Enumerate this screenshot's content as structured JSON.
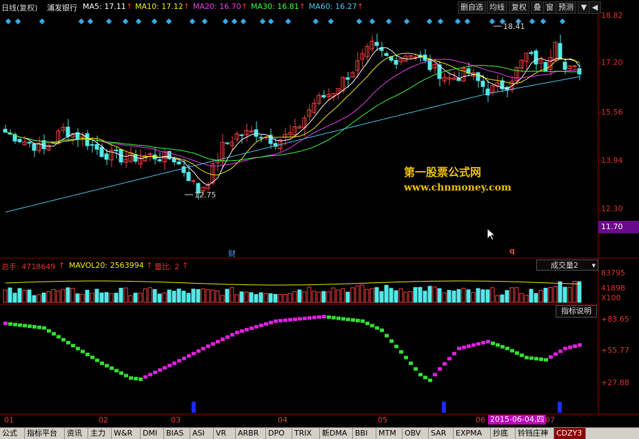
{
  "colors": {
    "up": "#ff4040",
    "down": "#54e8e8",
    "ma5": "#ffffff",
    "ma10": "#f0f000",
    "ma20": "#f040f0",
    "ma30": "#40ff40",
    "ma60": "#50c8f0",
    "grid": "#8b0000",
    "accent_red": "#e83030"
  },
  "topbar": {
    "period": "日线(复权)",
    "stock": "浦发银行",
    "ma5": "MA5: 17.11",
    "ma10": "MA10: 17.12",
    "ma20": "MA20: 16.70",
    "ma30": "MA30: 16.81",
    "ma60": "MA60: 16.27",
    "buttons": [
      "删自选",
      "均线",
      "复权",
      "叠",
      "窗",
      "预测"
    ],
    "menu_icon": "triangle-down-icon",
    "arrow_glyph": "↑"
  },
  "price_axis": {
    "labels": [
      "18.82",
      "17.20",
      "15.56",
      "13.94",
      "12.30"
    ],
    "current": "11.70"
  },
  "annotations": {
    "high": "18.41",
    "low": "12.75",
    "cai": "财",
    "q": "q"
  },
  "watermark": {
    "line1": "第一股票公式网",
    "line2": "www.chnmoney.com"
  },
  "volume": {
    "zongshou": "总手: 4718649",
    "mavol": "MAVOL20: 2563994",
    "liangbi": "量比: 2",
    "dropdown": "成交量2",
    "labels": [
      "83795",
      "41898",
      "X100"
    ]
  },
  "indicator": {
    "button": "指标说明",
    "labels": [
      "+83.65",
      "+55.77",
      "+27.88"
    ]
  },
  "x_axis": {
    "labels": [
      "01",
      "02",
      "03",
      "04",
      "05",
      "06",
      "07"
    ],
    "date": "2015-06-04,四"
  },
  "tabs": [
    "公式",
    "指标平台",
    "资讯",
    "主力",
    "W&R",
    "DMI",
    "BIAS",
    "ASI",
    "VR",
    "ARBR",
    "DPO",
    "TRIX",
    "新DMA",
    "BBI",
    "MTM",
    "OBV",
    "SAR",
    "EXPMA",
    "抄底",
    "铃铛庄神",
    "CDZY3"
  ]
}
